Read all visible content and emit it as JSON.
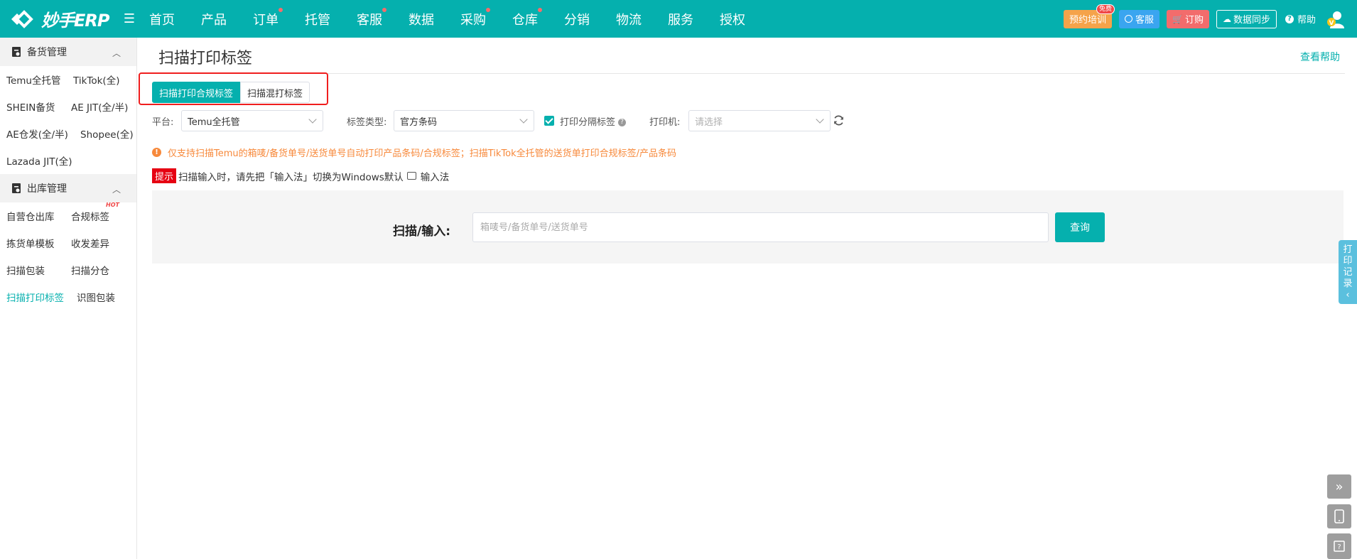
{
  "brand": {
    "name": "妙手ERP",
    "color": "#05b0ae"
  },
  "nav": {
    "items": [
      {
        "label": "首页",
        "dot": false
      },
      {
        "label": "产品",
        "dot": false
      },
      {
        "label": "订单",
        "dot": true
      },
      {
        "label": "托管",
        "dot": false
      },
      {
        "label": "客服",
        "dot": true
      },
      {
        "label": "数据",
        "dot": false
      },
      {
        "label": "采购",
        "dot": true
      },
      {
        "label": "仓库",
        "dot": true
      },
      {
        "label": "分销",
        "dot": false
      },
      {
        "label": "物流",
        "dot": false
      },
      {
        "label": "服务",
        "dot": false
      },
      {
        "label": "授权",
        "dot": false
      }
    ]
  },
  "topbar": {
    "training": "预约培训",
    "training_badge": "免费",
    "service": "客服",
    "order": "订购",
    "sync": "数据同步",
    "help": "帮助"
  },
  "sidebar": {
    "groups": [
      {
        "title": "备货管理",
        "rows": [
          [
            "Temu全托管",
            "TikTok(全)"
          ],
          [
            "SHEIN备货",
            "AE JIT(全/半)"
          ],
          [
            "AE仓发(全/半)",
            "Shopee(全)"
          ],
          [
            "Lazada JIT(全)"
          ]
        ]
      },
      {
        "title": "出库管理",
        "rows": [
          [
            "自营仓出库",
            "合规标签"
          ],
          [
            "拣货单模板",
            "收发差异"
          ],
          [
            "扫描包装",
            "扫描分仓"
          ],
          [
            "扫描打印标签",
            "识图包装"
          ]
        ]
      }
    ],
    "hot_label": "HOT"
  },
  "page": {
    "title": "扫描打印标签",
    "help_link": "查看帮助",
    "tabs": [
      "扫描打印合规标签",
      "扫描混打标签"
    ],
    "filters": {
      "platform_label": "平台:",
      "platform_value": "Temu全托管",
      "label_type_label": "标签类型:",
      "label_type_value": "官方条码",
      "print_separator": "打印分隔标签",
      "printer_label": "打印机:",
      "printer_placeholder": "请选择"
    },
    "notice": "仅支持扫描Temu的箱唛/备货单号/送货单号自动打印产品条码/合规标签；扫描TikTok全托管的送货单打印合规标签/产品条码",
    "tip_badge": "提示",
    "tip_text": "扫描输入时，请先把「输入法」切换为Windows默认",
    "tip_ime": "输入法",
    "scan_label": "扫描/输入:",
    "scan_placeholder": "箱唛号/备货单号/送货单号",
    "query_button": "查询",
    "print_record": [
      "打",
      "印",
      "记",
      "录"
    ]
  }
}
